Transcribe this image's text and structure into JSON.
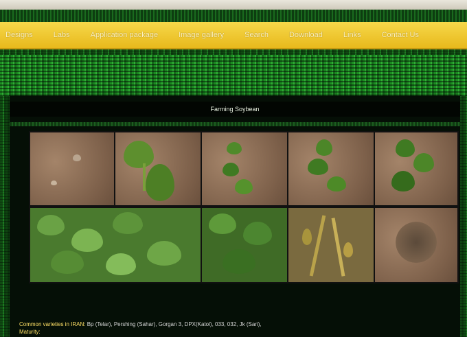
{
  "nav": {
    "items": [
      {
        "label": "Designs"
      },
      {
        "label": "Labs"
      },
      {
        "label": "Application package"
      },
      {
        "label": "Image gallery"
      },
      {
        "label": "Search"
      },
      {
        "label": "Download"
      },
      {
        "label": "Links"
      },
      {
        "label": "Contact Us"
      }
    ]
  },
  "panel": {
    "title": "Farming Soybean"
  },
  "info": {
    "varieties_label": "Common varieties in IRAN:",
    "varieties_value": "Bp (Telar), Pershing (Sahar), Gorgan 3, DPX(Katol), 033, 032, Jk (Sari),",
    "maturity_label": "Maturity:"
  },
  "colors": {
    "nav_bg": "#f0c830",
    "nav_text": "#fff4c2",
    "grass_green": "#1d7a22",
    "panel_bg": "#050f06",
    "label_yellow": "#ffe066"
  }
}
